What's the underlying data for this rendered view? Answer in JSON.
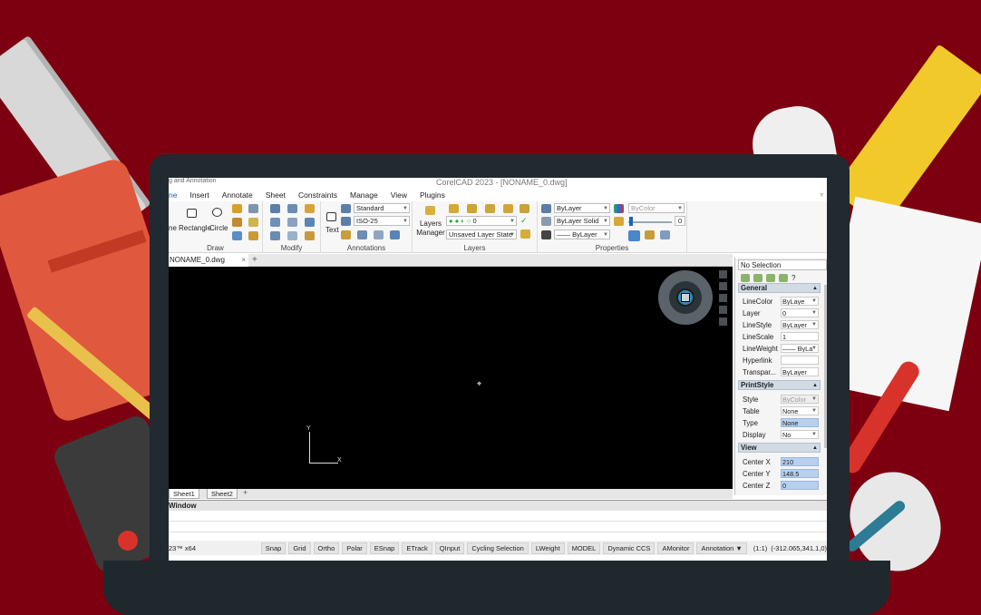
{
  "window": {
    "qat_label": "g and Annotation",
    "title": "CorelCAD 2023 - [NONAME_0.dwg]"
  },
  "menu": [
    "ne",
    "Insert",
    "Annotate",
    "Sheet",
    "Constraints",
    "Manage",
    "View",
    "Plugins"
  ],
  "ribbon": {
    "draw": {
      "label": "Draw",
      "line": "ne",
      "rectangle": "Rectangle",
      "circle": "Circle"
    },
    "modify": {
      "label": "Modify"
    },
    "annotations": {
      "label": "Annotations",
      "text": "Text",
      "text_style": "Standard",
      "dim_style": "ISO-25"
    },
    "layers": {
      "label": "Layers",
      "manager": "Layers Manager",
      "layer_combo": "0",
      "state_combo": "Unsaved Layer State"
    },
    "properties": {
      "label": "Properties",
      "color": "ByLayer",
      "color2": "ByColor",
      "linestyle": "ByLayer",
      "linestyle_type": "Solid",
      "lineweight": "ByLayer",
      "transparency_value": "0"
    }
  },
  "document": {
    "tab_name": "NONAME_0.dwg",
    "close": "×",
    "add": "+"
  },
  "canvas": {
    "ucs_x": "X",
    "ucs_y": "Y"
  },
  "sheets": [
    "Sheet1",
    "Sheet2"
  ],
  "sheet_add": "+",
  "command_window": {
    "header": "Window"
  },
  "statusbar": {
    "version": "23™ x64",
    "toggles": [
      "Snap",
      "Grid",
      "Ortho",
      "Polar",
      "ESnap",
      "ETrack",
      "QInput",
      "Cycling Selection",
      "LWeight",
      "MODEL",
      "Dynamic CCS",
      "AMonitor"
    ],
    "annotation": "Annotation",
    "scale": "(1:1)",
    "coordinates": "(-312.065,341.1,0)"
  },
  "properties_panel": {
    "selection": "No Selection",
    "help": "?",
    "general": {
      "title": "General",
      "rows": [
        {
          "key": "LineColor",
          "value": "ByLaye"
        },
        {
          "key": "Layer",
          "value": "0"
        },
        {
          "key": "LineStyle",
          "value": "ByLayer"
        },
        {
          "key": "LineScale",
          "value": "1"
        },
        {
          "key": "LineWeight",
          "value": "—— ByLa"
        },
        {
          "key": "Hyperlink",
          "value": ""
        },
        {
          "key": "Transpar...",
          "value": "ByLayer"
        }
      ]
    },
    "printstyle": {
      "title": "PrintStyle",
      "rows": [
        {
          "key": "Style",
          "value": "ByColor"
        },
        {
          "key": "Table",
          "value": "None"
        },
        {
          "key": "Type",
          "value": "None"
        },
        {
          "key": "Display",
          "value": "No"
        }
      ]
    },
    "view": {
      "title": "View",
      "rows": [
        {
          "key": "Center X",
          "value": "210"
        },
        {
          "key": "Center Y",
          "value": "148.5"
        },
        {
          "key": "Center Z",
          "value": "0"
        }
      ]
    }
  },
  "colors": {
    "background": "#7d0010",
    "accent": "#1c63b0",
    "canvas": "#000000"
  }
}
